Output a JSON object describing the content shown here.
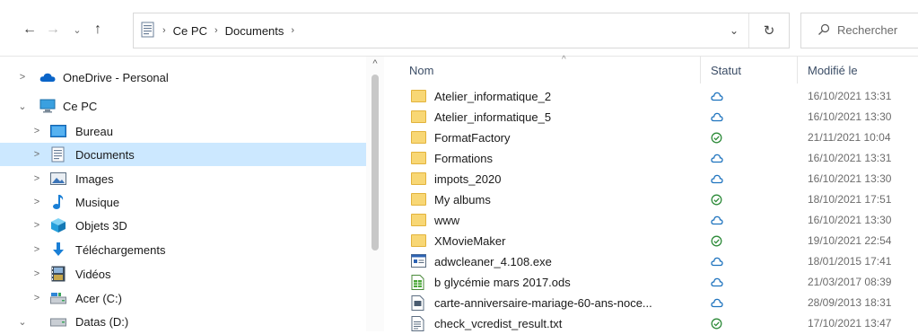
{
  "toolbar": {
    "back_glyph": "←",
    "forward_glyph": "→",
    "recent_glyph": "⌄",
    "up_glyph": "↑",
    "breadcrumb": [
      "Ce PC",
      "Documents"
    ],
    "dropdown_glyph": "⌄",
    "refresh_glyph": "↻",
    "search_placeholder": "Rechercher"
  },
  "nav": {
    "items": [
      {
        "label": "OneDrive - Personal",
        "chevron": ">",
        "icon": "onedrive-cloud-icon",
        "indent": 0
      },
      {
        "label": "Ce PC",
        "chevron": "⌄",
        "icon": "computer-icon",
        "indent": 0
      },
      {
        "label": "Bureau",
        "chevron": ">",
        "icon": "desktop-icon",
        "indent": 1
      },
      {
        "label": "Documents",
        "chevron": ">",
        "icon": "documents-icon",
        "indent": 1,
        "selected": true
      },
      {
        "label": "Images",
        "chevron": ">",
        "icon": "pictures-icon",
        "indent": 1
      },
      {
        "label": "Musique",
        "chevron": ">",
        "icon": "music-icon",
        "indent": 1
      },
      {
        "label": "Objets 3D",
        "chevron": ">",
        "icon": "3d-objects-icon",
        "indent": 1
      },
      {
        "label": "Téléchargements",
        "chevron": ">",
        "icon": "downloads-icon",
        "indent": 1
      },
      {
        "label": "Vidéos",
        "chevron": ">",
        "icon": "videos-icon",
        "indent": 1
      },
      {
        "label": "Acer (C:)",
        "chevron": ">",
        "icon": "drive-c-icon",
        "indent": 1
      },
      {
        "label": "Datas (D:)",
        "chevron": "⌄",
        "icon": "drive-d-icon",
        "indent": 1
      }
    ],
    "scroll_up_glyph": "^"
  },
  "list": {
    "columns": {
      "name": "Nom",
      "status": "Statut",
      "modified": "Modifié le"
    },
    "sort_glyph": "^",
    "rows": [
      {
        "name": "Atelier_informatique_2",
        "type": "folder",
        "status": "cloud",
        "modified": "16/10/2021 13:31"
      },
      {
        "name": "Atelier_informatique_5",
        "type": "folder",
        "status": "cloud",
        "modified": "16/10/2021 13:30"
      },
      {
        "name": "FormatFactory",
        "type": "folder",
        "status": "synced",
        "modified": "21/11/2021 10:04"
      },
      {
        "name": "Formations",
        "type": "folder",
        "status": "cloud",
        "modified": "16/10/2021 13:31"
      },
      {
        "name": "impots_2020",
        "type": "folder",
        "status": "cloud",
        "modified": "16/10/2021 13:30"
      },
      {
        "name": "My albums",
        "type": "folder",
        "status": "synced",
        "modified": "18/10/2021 17:51"
      },
      {
        "name": "www",
        "type": "folder",
        "status": "cloud",
        "modified": "16/10/2021 13:30"
      },
      {
        "name": "XMovieMaker",
        "type": "folder",
        "status": "synced",
        "modified": "19/10/2021 22:54"
      },
      {
        "name": "adwcleaner_4.108.exe",
        "type": "exe",
        "status": "cloud",
        "modified": "18/01/2015 17:41"
      },
      {
        "name": "b glycémie mars 2017.ods",
        "type": "ods",
        "status": "cloud",
        "modified": "21/03/2017 08:39"
      },
      {
        "name": "carte-anniversaire-mariage-60-ans-noce...",
        "type": "doc",
        "status": "cloud",
        "modified": "28/09/2013 18:31"
      },
      {
        "name": "check_vcredist_result.txt",
        "type": "txt",
        "status": "synced",
        "modified": "17/10/2021 13:47"
      }
    ]
  },
  "colors": {
    "selected_bg": "#cce8ff",
    "folder": "#f8d775",
    "cloud_status": "#1e73be",
    "synced_status": "#2e8b3a",
    "header_text": "#3b4d66"
  }
}
